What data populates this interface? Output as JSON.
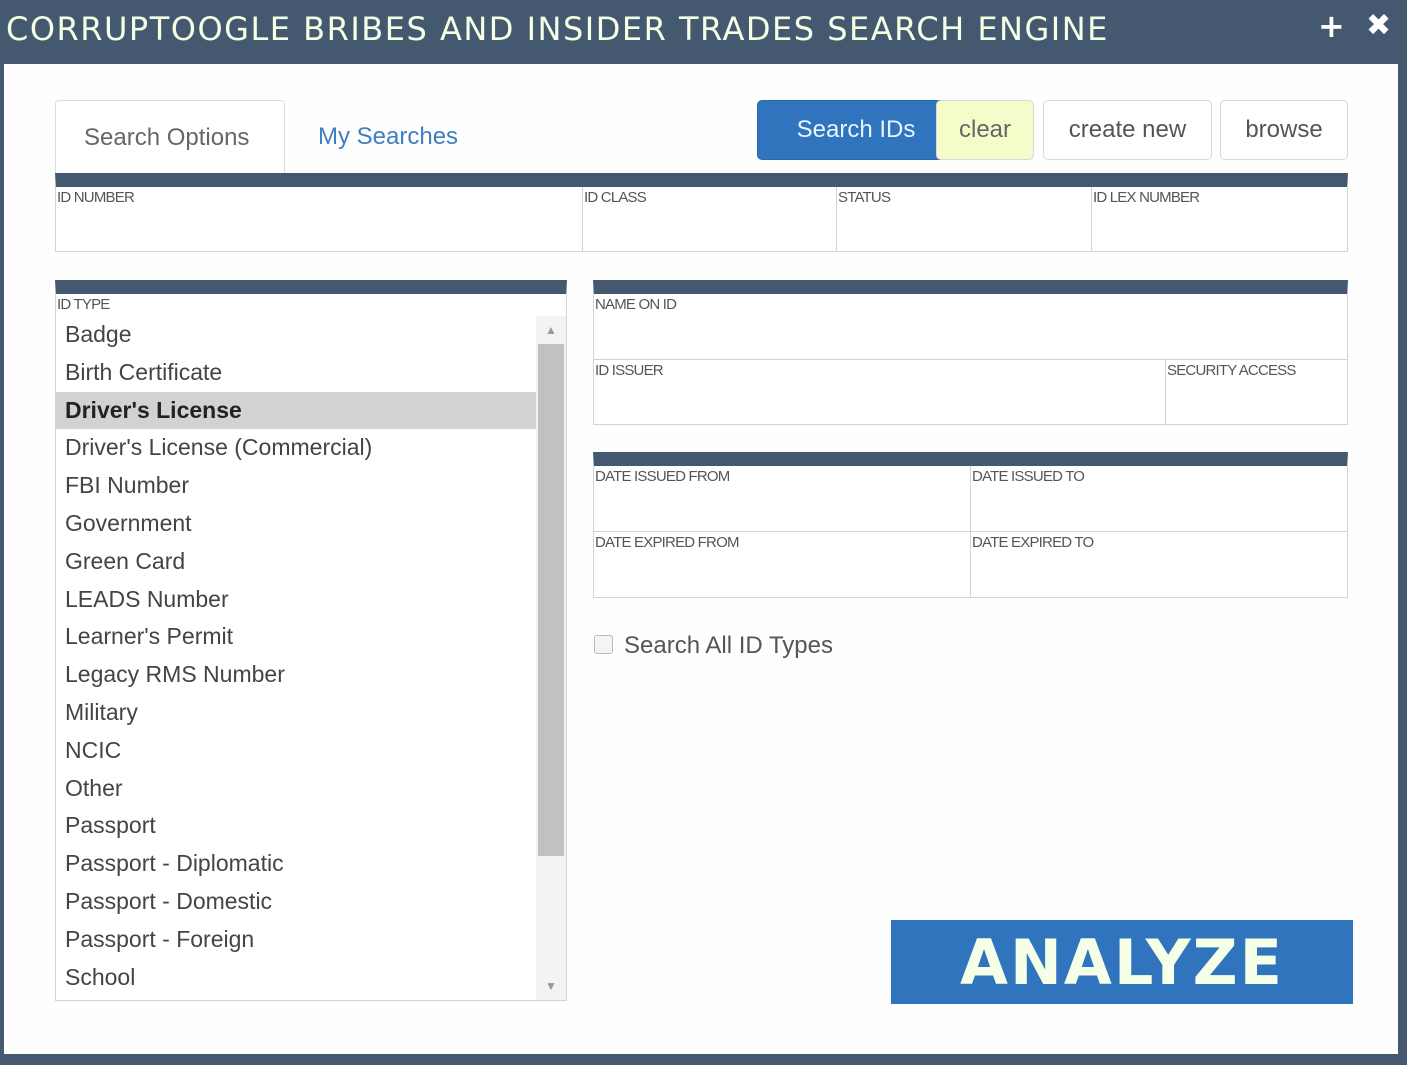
{
  "window": {
    "title": "CORRUPTOOGLE BRIBES AND INSIDER TRADES SEARCH ENGINE",
    "add_icon": "plus-icon",
    "close_icon": "close-icon",
    "add_glyph": "+",
    "close_glyph": "✖"
  },
  "tabs": [
    {
      "label": "Search Options",
      "active": true
    },
    {
      "label": "My Searches",
      "active": false
    }
  ],
  "toolbar": {
    "search_label": "Search IDs",
    "clear_label": "clear",
    "create_label": "create new",
    "browse_label": "browse"
  },
  "id_fields": {
    "id_number": {
      "label": "ID NUMBER",
      "value": ""
    },
    "id_class": {
      "label": "ID CLASS",
      "value": ""
    },
    "status": {
      "label": "STATUS",
      "value": ""
    },
    "id_lex_number": {
      "label": "ID LEX NUMBER",
      "value": ""
    }
  },
  "id_type": {
    "label": "ID TYPE",
    "selected": "Driver's License",
    "options": [
      "Badge",
      "Birth Certificate",
      "Driver's License",
      "Driver's License (Commercial)",
      "FBI Number",
      "Government",
      "Green Card",
      "LEADS Number",
      "Learner's Permit",
      "Legacy RMS Number",
      "Military",
      "NCIC",
      "Other",
      "Passport",
      "Passport - Diplomatic",
      "Passport - Domestic",
      "Passport - Foreign",
      "School"
    ],
    "scroll_up_glyph": "▲",
    "scroll_down_glyph": "▼"
  },
  "holder_fields": {
    "name_on_id": {
      "label": "NAME ON ID",
      "value": ""
    },
    "id_issuer": {
      "label": "ID ISSUER",
      "value": ""
    },
    "security_access": {
      "label": "SECURITY ACCESS",
      "value": ""
    }
  },
  "date_fields": {
    "date_issued_from": {
      "label": "DATE ISSUED FROM",
      "value": ""
    },
    "date_issued_to": {
      "label": "DATE ISSUED TO",
      "value": ""
    },
    "date_expired_from": {
      "label": "DATE EXPIRED FROM",
      "value": ""
    },
    "date_expired_to": {
      "label": "DATE EXPIRED TO",
      "value": ""
    }
  },
  "search_all": {
    "label": "Search All ID Types",
    "checked": false
  },
  "analyze_label": "ANALYZE",
  "colors": {
    "header": "#44596f",
    "primary": "#2f74bd",
    "clear_bg": "#f5fbc9",
    "selected_row": "#d2d2d2"
  }
}
